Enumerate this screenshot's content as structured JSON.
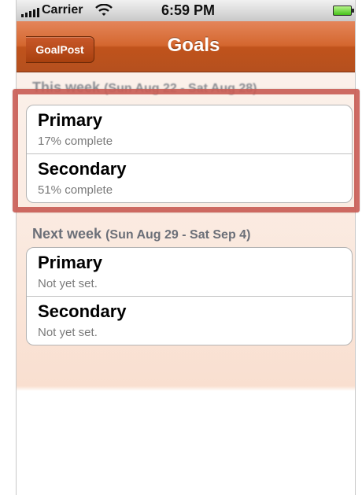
{
  "status_bar": {
    "carrier": "Carrier",
    "time": "6:59 PM"
  },
  "nav": {
    "back_label": "GoalPost",
    "title": "Goals"
  },
  "sections": [
    {
      "title": "This week",
      "range": "(Sun Aug 22 - Sat Aug 28)",
      "items": [
        {
          "title": "Primary",
          "subtitle": "17% complete"
        },
        {
          "title": "Secondary",
          "subtitle": "51% complete"
        }
      ]
    },
    {
      "title": "Next week",
      "range": "(Sun Aug 29 - Sat Sep 4)",
      "items": [
        {
          "title": "Primary",
          "subtitle": "Not yet set."
        },
        {
          "title": "Secondary",
          "subtitle": "Not yet set."
        }
      ]
    }
  ],
  "colors": {
    "nav_bar": "#c0531c",
    "highlight_frame": "#c95c54",
    "section_header": "#6b6f78"
  }
}
